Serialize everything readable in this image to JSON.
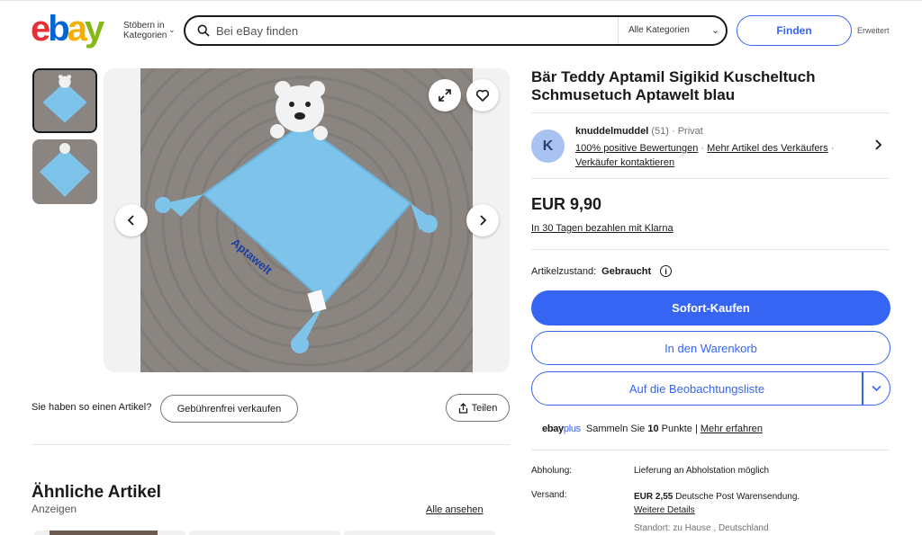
{
  "header": {
    "logo_letters": [
      {
        "ch": "e",
        "color": "#e53238"
      },
      {
        "ch": "b",
        "color": "#0064d2"
      },
      {
        "ch": "a",
        "color": "#f5af02"
      },
      {
        "ch": "y",
        "color": "#86b817"
      }
    ],
    "browse_line1": "Stöbern in",
    "browse_line2": "Kategorien",
    "search_placeholder": "Bei eBay finden",
    "category_select": "Alle Kategorien",
    "find_label": "Finden",
    "advanced_label": "Erweitert"
  },
  "gallery": {
    "thumbnail_count": 2,
    "selected_thumbnail": 1
  },
  "actions": {
    "sell_question": "Sie haben so einen Artikel?",
    "sell_button": "Gebührenfrei verkaufen",
    "share_button": "Teilen"
  },
  "similar": {
    "title": "Ähnliche Artikel",
    "subtitle": "Anzeigen",
    "see_all": "Alle ansehen"
  },
  "item": {
    "title": "Bär Teddy Aptamil Sigikid Kuscheltuch Schmusetuch Aptawelt blau",
    "price": "EUR 9,90",
    "klarna": "In 30 Tagen bezahlen mit Klarna",
    "condition_label": "Artikelzustand:",
    "condition_value": "Gebraucht",
    "buy_now": "Sofort-Kaufen",
    "add_to_cart": "In den Warenkorb",
    "watchlist": "Auf die Beobachtungsliste"
  },
  "seller": {
    "avatar_letter": "K",
    "name": "knuddelmuddel",
    "rating_count": "(51)",
    "type": "· Privat",
    "feedback": "100% positive Bewertungen",
    "more_items": "Mehr Artikel des Verkäufers",
    "contact": "Verkäufer kontaktieren"
  },
  "plus": {
    "logo_ebay": "ebay",
    "logo_plus": "plus",
    "collect": "Sammeln Sie",
    "points_num": "10",
    "points_word": "Punkte |",
    "learn_more": "Mehr erfahren"
  },
  "shipping": {
    "pickup_label": "Abholung:",
    "pickup_value": "Lieferung an Abholstation möglich",
    "ship_label": "Versand:",
    "ship_price": "EUR 2,55",
    "ship_desc": "Deutsche Post Warensendung.",
    "ship_details": "Weitere Details",
    "location": "Standort: zu Hause , Deutschland"
  },
  "colors": {
    "accent": "#3665f3",
    "product_blue": "#7ec3ea",
    "carpet": "#8a8581"
  }
}
